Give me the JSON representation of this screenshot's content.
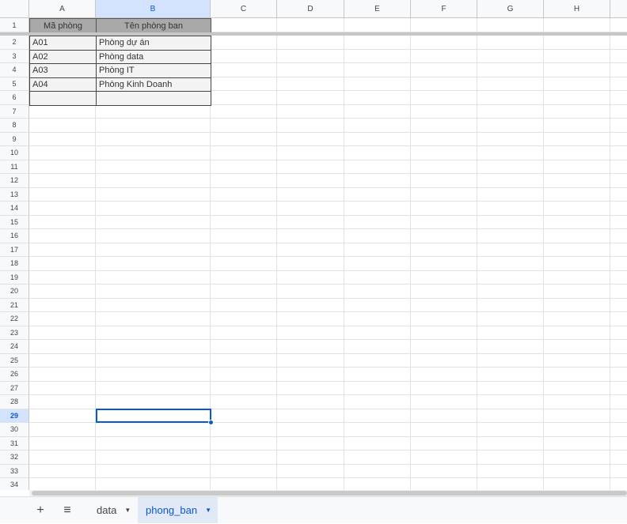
{
  "columns": [
    "A",
    "B",
    "C",
    "D",
    "E",
    "F",
    "G",
    "H",
    ""
  ],
  "selected_column": "B",
  "selected_row": 29,
  "row_count": 34,
  "header_row": [
    "Mã phòng",
    "Tên phòng ban"
  ],
  "rows": [
    [
      "A01",
      "Phòng dự án"
    ],
    [
      "A02",
      "Phòng data"
    ],
    [
      "A03",
      "Phòng IT"
    ],
    [
      "A04",
      "Phòng Kinh Doanh"
    ],
    [
      "",
      ""
    ]
  ],
  "sheet_tabs": {
    "add_label": "+",
    "menu_label": "≡",
    "tabs": [
      {
        "label": "data",
        "active": false
      },
      {
        "label": "phong_ban",
        "active": true
      }
    ]
  },
  "colors": {
    "accent": "#0b57d0",
    "header_fill": "#a9a9a9"
  }
}
